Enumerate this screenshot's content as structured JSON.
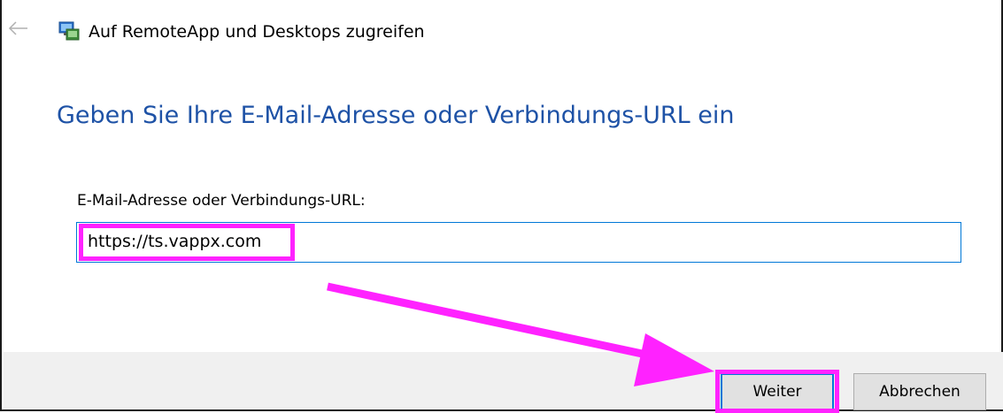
{
  "window": {
    "title": "Auf RemoteApp und Desktops zugreifen",
    "back_icon": "arrow-left-icon",
    "app_icon": "remoteapp-icon"
  },
  "main": {
    "heading": "Geben Sie Ihre E-Mail-Adresse oder Verbindungs-URL ein",
    "field_label": "E-Mail-Adresse oder Verbindungs-URL:",
    "field_value": "https://ts.vappx.com"
  },
  "footer": {
    "next_label": "Weiter",
    "cancel_label": "Abbrechen"
  },
  "colors": {
    "heading": "#1e52a6",
    "focus_border": "#0078d7",
    "annotation": "#ff22ff",
    "footer_bg": "#f0f0f0",
    "button_bg": "#e1e1e1"
  }
}
